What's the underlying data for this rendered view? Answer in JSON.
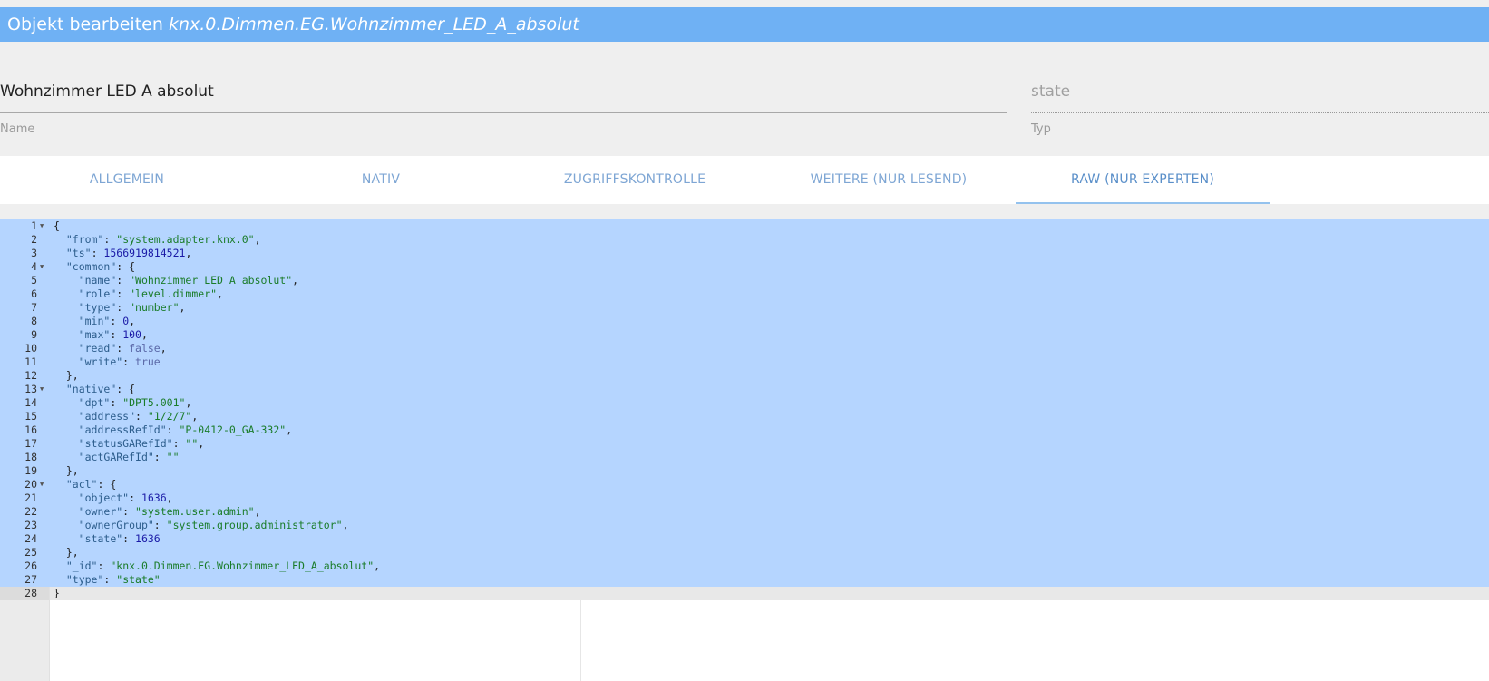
{
  "header": {
    "prefix": "Objekt bearbeiten",
    "object_id": "knx.0.Dimmen.EG.Wohnzimmer_LED_A_absolut"
  },
  "name_field": {
    "value": "Wohnzimmer LED A absolut",
    "label": "Name"
  },
  "type_field": {
    "value": "state",
    "label": "Typ"
  },
  "tabs": [
    {
      "label": "ALLGEMEIN",
      "active": false
    },
    {
      "label": "NATIV",
      "active": false
    },
    {
      "label": "ZUGRIFFSKONTROLLE",
      "active": false
    },
    {
      "label": "WEITERE (NUR LESEND)",
      "active": false
    },
    {
      "label": "RAW (NUR EXPERTEN)",
      "active": true
    }
  ],
  "editor": {
    "active_line": 28,
    "lines": [
      {
        "n": "1",
        "fold": true,
        "tokens": [
          [
            "pun",
            "{"
          ]
        ]
      },
      {
        "n": "2",
        "fold": false,
        "tokens": [
          [
            "pun",
            "  "
          ],
          [
            "key",
            "\"from\""
          ],
          [
            "pun",
            ": "
          ],
          [
            "str",
            "\"system.adapter.knx.0\""
          ],
          [
            "pun",
            ","
          ]
        ]
      },
      {
        "n": "3",
        "fold": false,
        "tokens": [
          [
            "pun",
            "  "
          ],
          [
            "key",
            "\"ts\""
          ],
          [
            "pun",
            ": "
          ],
          [
            "num",
            "1566919814521"
          ],
          [
            "pun",
            ","
          ]
        ]
      },
      {
        "n": "4",
        "fold": true,
        "tokens": [
          [
            "pun",
            "  "
          ],
          [
            "key",
            "\"common\""
          ],
          [
            "pun",
            ": {"
          ]
        ]
      },
      {
        "n": "5",
        "fold": false,
        "tokens": [
          [
            "pun",
            "    "
          ],
          [
            "key",
            "\"name\""
          ],
          [
            "pun",
            ": "
          ],
          [
            "str",
            "\"Wohnzimmer LED A absolut\""
          ],
          [
            "pun",
            ","
          ]
        ]
      },
      {
        "n": "6",
        "fold": false,
        "tokens": [
          [
            "pun",
            "    "
          ],
          [
            "key",
            "\"role\""
          ],
          [
            "pun",
            ": "
          ],
          [
            "str",
            "\"level.dimmer\""
          ],
          [
            "pun",
            ","
          ]
        ]
      },
      {
        "n": "7",
        "fold": false,
        "tokens": [
          [
            "pun",
            "    "
          ],
          [
            "key",
            "\"type\""
          ],
          [
            "pun",
            ": "
          ],
          [
            "str",
            "\"number\""
          ],
          [
            "pun",
            ","
          ]
        ]
      },
      {
        "n": "8",
        "fold": false,
        "tokens": [
          [
            "pun",
            "    "
          ],
          [
            "key",
            "\"min\""
          ],
          [
            "pun",
            ": "
          ],
          [
            "num",
            "0"
          ],
          [
            "pun",
            ","
          ]
        ]
      },
      {
        "n": "9",
        "fold": false,
        "tokens": [
          [
            "pun",
            "    "
          ],
          [
            "key",
            "\"max\""
          ],
          [
            "pun",
            ": "
          ],
          [
            "num",
            "100"
          ],
          [
            "pun",
            ","
          ]
        ]
      },
      {
        "n": "10",
        "fold": false,
        "tokens": [
          [
            "pun",
            "    "
          ],
          [
            "key",
            "\"read\""
          ],
          [
            "pun",
            ": "
          ],
          [
            "bool",
            "false"
          ],
          [
            "pun",
            ","
          ]
        ]
      },
      {
        "n": "11",
        "fold": false,
        "tokens": [
          [
            "pun",
            "    "
          ],
          [
            "key",
            "\"write\""
          ],
          [
            "pun",
            ": "
          ],
          [
            "bool",
            "true"
          ]
        ]
      },
      {
        "n": "12",
        "fold": false,
        "tokens": [
          [
            "pun",
            "  },"
          ]
        ]
      },
      {
        "n": "13",
        "fold": true,
        "tokens": [
          [
            "pun",
            "  "
          ],
          [
            "key",
            "\"native\""
          ],
          [
            "pun",
            ": {"
          ]
        ]
      },
      {
        "n": "14",
        "fold": false,
        "tokens": [
          [
            "pun",
            "    "
          ],
          [
            "key",
            "\"dpt\""
          ],
          [
            "pun",
            ": "
          ],
          [
            "str",
            "\"DPT5.001\""
          ],
          [
            "pun",
            ","
          ]
        ]
      },
      {
        "n": "15",
        "fold": false,
        "tokens": [
          [
            "pun",
            "    "
          ],
          [
            "key",
            "\"address\""
          ],
          [
            "pun",
            ": "
          ],
          [
            "str",
            "\"1/2/7\""
          ],
          [
            "pun",
            ","
          ]
        ]
      },
      {
        "n": "16",
        "fold": false,
        "tokens": [
          [
            "pun",
            "    "
          ],
          [
            "key",
            "\"addressRefId\""
          ],
          [
            "pun",
            ": "
          ],
          [
            "str",
            "\"P-0412-0_GA-332\""
          ],
          [
            "pun",
            ","
          ]
        ]
      },
      {
        "n": "17",
        "fold": false,
        "tokens": [
          [
            "pun",
            "    "
          ],
          [
            "key",
            "\"statusGARefId\""
          ],
          [
            "pun",
            ": "
          ],
          [
            "str",
            "\"\""
          ],
          [
            "pun",
            ","
          ]
        ]
      },
      {
        "n": "18",
        "fold": false,
        "tokens": [
          [
            "pun",
            "    "
          ],
          [
            "key",
            "\"actGARefId\""
          ],
          [
            "pun",
            ": "
          ],
          [
            "str",
            "\"\""
          ]
        ]
      },
      {
        "n": "19",
        "fold": false,
        "tokens": [
          [
            "pun",
            "  },"
          ]
        ]
      },
      {
        "n": "20",
        "fold": true,
        "tokens": [
          [
            "pun",
            "  "
          ],
          [
            "key",
            "\"acl\""
          ],
          [
            "pun",
            ": {"
          ]
        ]
      },
      {
        "n": "21",
        "fold": false,
        "tokens": [
          [
            "pun",
            "    "
          ],
          [
            "key",
            "\"object\""
          ],
          [
            "pun",
            ": "
          ],
          [
            "num",
            "1636"
          ],
          [
            "pun",
            ","
          ]
        ]
      },
      {
        "n": "22",
        "fold": false,
        "tokens": [
          [
            "pun",
            "    "
          ],
          [
            "key",
            "\"owner\""
          ],
          [
            "pun",
            ": "
          ],
          [
            "str",
            "\"system.user.admin\""
          ],
          [
            "pun",
            ","
          ]
        ]
      },
      {
        "n": "23",
        "fold": false,
        "tokens": [
          [
            "pun",
            "    "
          ],
          [
            "key",
            "\"ownerGroup\""
          ],
          [
            "pun",
            ": "
          ],
          [
            "str",
            "\"system.group.administrator\""
          ],
          [
            "pun",
            ","
          ]
        ]
      },
      {
        "n": "24",
        "fold": false,
        "tokens": [
          [
            "pun",
            "    "
          ],
          [
            "key",
            "\"state\""
          ],
          [
            "pun",
            ": "
          ],
          [
            "num",
            "1636"
          ]
        ]
      },
      {
        "n": "25",
        "fold": false,
        "tokens": [
          [
            "pun",
            "  },"
          ]
        ]
      },
      {
        "n": "26",
        "fold": false,
        "tokens": [
          [
            "pun",
            "  "
          ],
          [
            "key",
            "\"_id\""
          ],
          [
            "pun",
            ": "
          ],
          [
            "str",
            "\"knx.0.Dimmen.EG.Wohnzimmer_LED_A_absolut\""
          ],
          [
            "pun",
            ","
          ]
        ]
      },
      {
        "n": "27",
        "fold": false,
        "tokens": [
          [
            "pun",
            "  "
          ],
          [
            "key",
            "\"type\""
          ],
          [
            "pun",
            ": "
          ],
          [
            "str",
            "\"state\""
          ]
        ]
      },
      {
        "n": "28",
        "fold": false,
        "tokens": [
          [
            "pun",
            "}"
          ]
        ]
      }
    ]
  },
  "colors": {
    "title_bar": "#6fb1f4",
    "selection": "#b5d5ff",
    "tab_text": "#7ea6d4",
    "tab_indicator": "#94c2ee"
  }
}
